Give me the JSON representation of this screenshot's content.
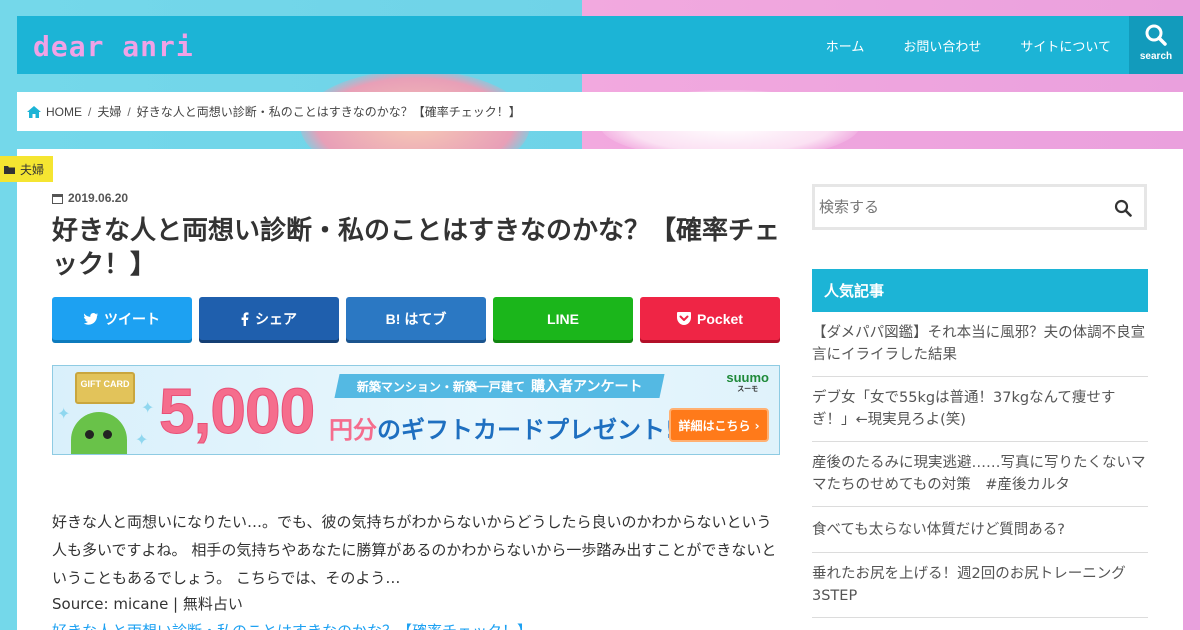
{
  "site": {
    "logo": "dear anri",
    "nav": [
      "ホーム",
      "お問い合わせ",
      "サイトについて"
    ],
    "search_label": "search"
  },
  "breadcrumb": {
    "home": "HOME",
    "category": "夫婦",
    "current": "好きな人と両想い診断・私のことはすきなのかな？【確率チェック！】"
  },
  "article": {
    "category_badge": "夫婦",
    "date": "2019.06.20",
    "title": "好きな人と両想い診断・私のことはすきなのかな？【確率チェック！】",
    "share": {
      "twitter": "ツイート",
      "facebook": "シェア",
      "hatebu": "B! はてブ",
      "line": "LINE",
      "pocket": "Pocket"
    },
    "banner": {
      "gift_card": "GIFT CARD",
      "subtitle": "新築マンション・新築一戸建て",
      "subtitle_big": "購入者アンケート",
      "amount": "5,000",
      "yen": "円分",
      "present": "のギフトカードプレゼント!",
      "brand": "suumo",
      "brand_sub": "スーモ",
      "detail": "詳細はこちら ›"
    },
    "body": "好きな人と両想いになりたい…。でも、彼の気持ちがわからないからどうしたら良いのかわからないという人も多いですよね。 相手の気持ちやあなたに勝算があるのかわからないから一歩踏み出すことができないということもあるでしょう。 こちらでは、そのよう…",
    "source": "Source: micane | 無料占い",
    "link": "好きな人と両想い診断・私のことはすきなのかな？【確率チェック！】"
  },
  "sidebar": {
    "search_placeholder": "検索する",
    "popular_title": "人気記事",
    "popular_items": [
      "【ダメパパ図鑑】それ本当に風邪？夫の体調不良宣言にイライラした結果",
      "デブ女「女で55kgは普通！37kgなんて痩せすぎ！」←現実見ろよ(笑)",
      "産後のたるみに現実逃避……写真に写りたくないママたちのせめてもの対策　#産後カルタ",
      "食べても太らない体質だけど質問ある?",
      "垂れたお尻を上げる！週2回のお尻トレーニング3STEP"
    ]
  },
  "colors": {
    "header": "#1cb4d6",
    "logo": "#f0a2e6",
    "badge": "#f5e531"
  }
}
